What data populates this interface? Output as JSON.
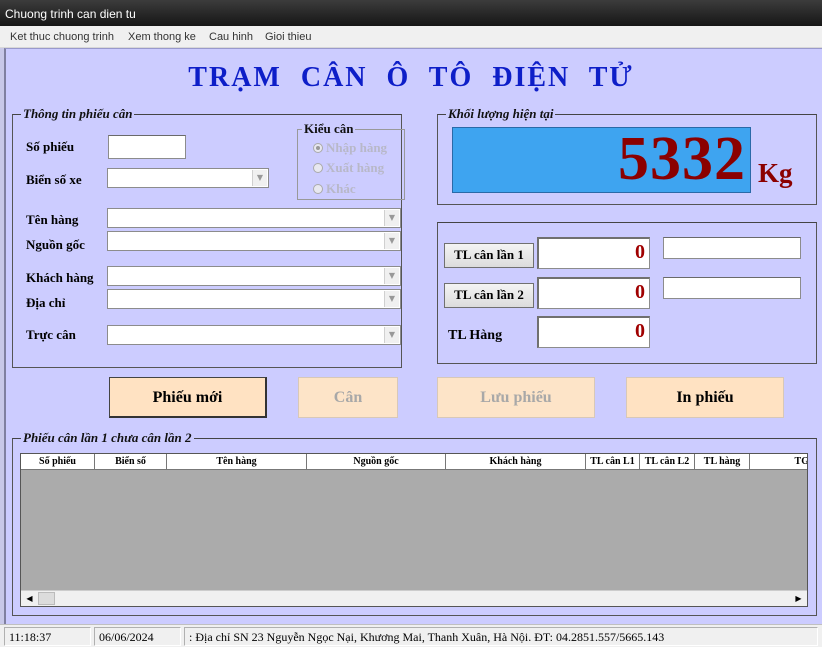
{
  "window": {
    "title": "Chuong trinh can dien tu"
  },
  "menu": [
    "Ket thuc chuong trinh",
    "Xem thong ke",
    "Cau hinh",
    "Gioi thieu"
  ],
  "app_title": "TRẠM CÂN Ô TÔ ĐIỆN TỬ",
  "ticket_group": {
    "legend": "Thông tin phiếu cân",
    "so_phieu_label": "Số phiếu",
    "so_phieu_value": "",
    "bien_so_label": "Biển số xe",
    "bien_so_value": "",
    "ten_hang_label": "Tên hàng",
    "ten_hang_value": "",
    "nguon_goc_label": "Nguồn gốc",
    "nguon_goc_value": "",
    "khach_hang_label": "Khách hàng",
    "khach_hang_value": "",
    "dia_chi_label": "Địa chỉ",
    "dia_chi_value": "",
    "truc_can_label": "Trực cân",
    "truc_can_value": "",
    "kieu_can": {
      "legend": "Kiểu cân",
      "options": [
        "Nhập hàng",
        "Xuất hàng",
        "Khác"
      ],
      "selected": "Nhập hàng"
    }
  },
  "weight": {
    "legend": "Khối lượng hiện tại",
    "value": "5332",
    "unit": "Kg"
  },
  "weighing": {
    "lan1_button": "TL cân lần 1",
    "lan1_value": "0",
    "lan1_note": "",
    "lan2_button": "TL cân lần 2",
    "lan2_value": "0",
    "lan2_note": "",
    "hang_label": "TL Hàng",
    "hang_value": "0"
  },
  "buttons": {
    "phieu_moi": "Phiếu mới",
    "can": "Cân",
    "luu_phieu": "Lưu phiếu",
    "in_phieu": "In phiếu"
  },
  "pending": {
    "legend": "Phiếu cân lần 1 chưa cân lần 2",
    "columns": [
      "Số phiếu",
      "Biển số",
      "Tên hàng",
      "Nguồn gốc",
      "Khách hàng",
      "TL cân L1",
      "TL cân L2",
      "TL hàng",
      "TG"
    ],
    "rows": []
  },
  "status": {
    "time": "11:18:37",
    "date": "06/06/2024",
    "address": ": Địa chỉ SN 23 Nguyễn Ngọc Nại, Khương Mai, Thanh Xuân, Hà Nội. ĐT: 04.2851.557/5665.143"
  },
  "colors": {
    "client_bg": "#ccccff",
    "weight_display_bg": "#3ea4f0",
    "weight_text": "#8b0000",
    "title_text": "#0d1ec8"
  }
}
